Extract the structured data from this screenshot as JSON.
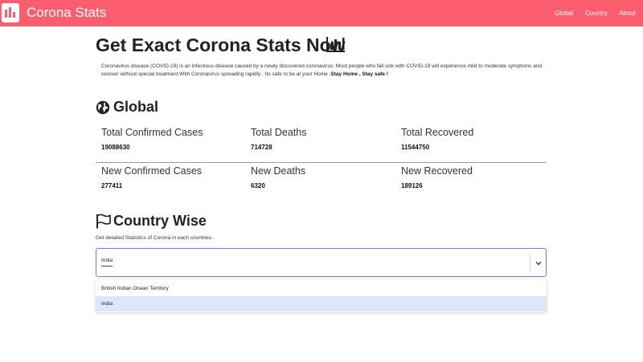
{
  "navbar": {
    "brand": "Corona Stats",
    "links": [
      "Global",
      "Country",
      "About"
    ],
    "color": "#fd5e6f"
  },
  "header": {
    "title": "Get Exact Corona Stats Now",
    "intro_text": "Coronavirus disease (COVID-19) is an infectious disease caused by a newly discovered coronavirus. Most people who fall sick with COVID-19 will experience mild to moderate symptoms and recover without special treatment.With Coronavirus spreading rapidly , Its safe to be at your Home .",
    "intro_bold": "Stay Home , Stay safe !"
  },
  "global": {
    "title": "Global",
    "stats": [
      {
        "label": "Total Confirmed Cases",
        "value": "19088630"
      },
      {
        "label": "Total Deaths",
        "value": "714728"
      },
      {
        "label": "Total Recovered",
        "value": "11544750"
      },
      {
        "label": "New Confirmed Cases",
        "value": "277411"
      },
      {
        "label": "New Deaths",
        "value": "6320"
      },
      {
        "label": "New Recovered",
        "value": "189126"
      }
    ]
  },
  "country": {
    "title": "Country Wise",
    "description": "Get detailed Statistics of Corona in each countries .",
    "select_value": "India",
    "options": [
      "British Indian Ocean Territory",
      "India"
    ],
    "selected_option": "India"
  }
}
